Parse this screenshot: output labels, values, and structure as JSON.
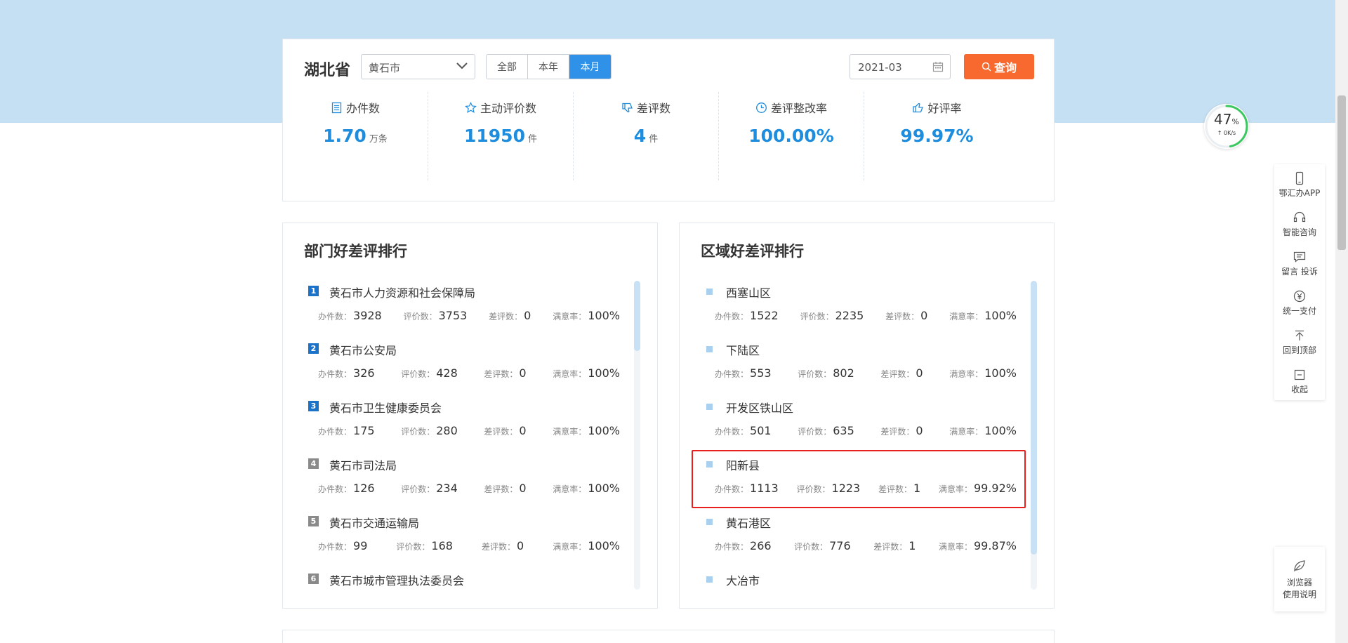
{
  "header": {
    "province": "湖北省",
    "city_select": "黄石市",
    "period_tabs": [
      "全部",
      "本年",
      "本月"
    ],
    "active_period": "本月",
    "date": "2021-03",
    "query_label": "查询"
  },
  "metrics": [
    {
      "label": "办件数",
      "value": "1.70",
      "unit": "万条",
      "icon": "list-icon"
    },
    {
      "label": "主动评价数",
      "value": "11950",
      "unit": "件",
      "icon": "star-icon"
    },
    {
      "label": "差评数",
      "value": "4",
      "unit": "件",
      "icon": "thumb-down-icon"
    },
    {
      "label": "差评整改率",
      "value": "100.00%",
      "unit": "",
      "icon": "clock-icon"
    },
    {
      "label": "好评率",
      "value": "99.97%",
      "unit": "",
      "icon": "thumb-up-icon"
    }
  ],
  "stat_labels": {
    "handle": "办件数：",
    "eval": "评价数：",
    "bad": "差评数：",
    "sat": "满意率："
  },
  "dept_ranking": {
    "title": "部门好差评排行",
    "items": [
      {
        "rank": "1",
        "name": "黄石市人力资源和社会保障局",
        "handle": "3928",
        "eval": "3753",
        "bad": "0",
        "sat": "100%"
      },
      {
        "rank": "2",
        "name": "黄石市公安局",
        "handle": "326",
        "eval": "428",
        "bad": "0",
        "sat": "100%"
      },
      {
        "rank": "3",
        "name": "黄石市卫生健康委员会",
        "handle": "175",
        "eval": "280",
        "bad": "0",
        "sat": "100%"
      },
      {
        "rank": "4",
        "name": "黄石市司法局",
        "handle": "126",
        "eval": "234",
        "bad": "0",
        "sat": "100%"
      },
      {
        "rank": "5",
        "name": "黄石市交通运输局",
        "handle": "99",
        "eval": "168",
        "bad": "0",
        "sat": "100%"
      },
      {
        "rank": "6",
        "name": "黄石市城市管理执法委员会",
        "handle": "",
        "eval": "",
        "bad": "",
        "sat": ""
      }
    ]
  },
  "region_ranking": {
    "title": "区域好差评排行",
    "items": [
      {
        "name": "西塞山区",
        "handle": "1522",
        "eval": "2235",
        "bad": "0",
        "sat": "100%"
      },
      {
        "name": "下陆区",
        "handle": "553",
        "eval": "802",
        "bad": "0",
        "sat": "100%"
      },
      {
        "name": "开发区铁山区",
        "handle": "501",
        "eval": "635",
        "bad": "0",
        "sat": "100%"
      },
      {
        "name": "阳新县",
        "handle": "1113",
        "eval": "1223",
        "bad": "1",
        "sat": "99.92%"
      },
      {
        "name": "黄石港区",
        "handle": "266",
        "eval": "776",
        "bad": "1",
        "sat": "99.87%"
      },
      {
        "name": "大冶市",
        "handle": "",
        "eval": "",
        "bad": "",
        "sat": ""
      }
    ]
  },
  "speed_widget": {
    "percent": "47",
    "percent_sign": "%",
    "rate": "↑ 0K/s",
    "progress": 0.47
  },
  "side_toolbar": [
    {
      "label": "鄂汇办APP",
      "icon": "phone-icon"
    },
    {
      "label": "智能咨询",
      "icon": "headset-icon"
    },
    {
      "label": "留言 投诉",
      "icon": "message-icon"
    },
    {
      "label": "统一支付",
      "icon": "yen-icon"
    },
    {
      "label": "回到顶部",
      "icon": "back-to-top-icon"
    },
    {
      "label": "收起",
      "icon": "collapse-icon"
    }
  ],
  "browser_help": {
    "line1": "浏览器",
    "line2": "使用说明"
  },
  "colors": {
    "accent": "#2f92e8",
    "query": "#f7692e",
    "value": "#1f8ddd",
    "highlight": "#e61f1f",
    "band": "#c5dff3"
  }
}
